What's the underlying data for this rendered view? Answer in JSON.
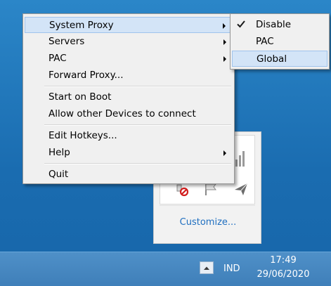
{
  "menu": {
    "items": [
      {
        "label": "System Proxy",
        "has_submenu": true,
        "highlighted": true
      },
      {
        "label": "Servers",
        "has_submenu": true
      },
      {
        "label": "PAC",
        "has_submenu": true
      },
      {
        "label": "Forward Proxy..."
      },
      {
        "label": "Start on Boot"
      },
      {
        "label": "Allow other Devices to connect"
      },
      {
        "label": "Edit Hotkeys..."
      },
      {
        "label": "Help",
        "has_submenu": true
      },
      {
        "label": "Quit"
      }
    ]
  },
  "submenu": {
    "items": [
      {
        "label": "Disable",
        "checked": true
      },
      {
        "label": "PAC",
        "checked": false
      },
      {
        "label": "Global",
        "checked": false,
        "highlighted": true
      }
    ]
  },
  "tray_flyout": {
    "customize_label": "Customize...",
    "icons": [
      "signal-bars-icon",
      "blocked-icon",
      "flag-icon",
      "paper-plane-icon"
    ]
  },
  "taskbar": {
    "show_hidden_icon": "chevron-up-icon",
    "language": "IND",
    "time": "17:49",
    "date": "29/06/2020"
  },
  "colors": {
    "menu_highlight": "#d3e4f7",
    "menu_highlight_border": "#9fc3ec",
    "link": "#1f6fc0",
    "taskbar": "#4585be"
  }
}
